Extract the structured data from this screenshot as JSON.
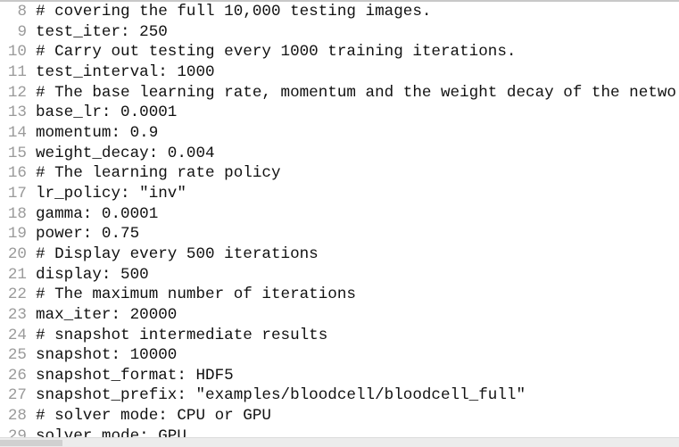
{
  "editor": {
    "lines": [
      {
        "n": "8",
        "text": "# covering the full 10,000 testing images."
      },
      {
        "n": "9",
        "text": "test_iter: 250"
      },
      {
        "n": "10",
        "text": "# Carry out testing every 1000 training iterations."
      },
      {
        "n": "11",
        "text": "test_interval: 1000"
      },
      {
        "n": "12",
        "text": "# The base learning rate, momentum and the weight decay of the netwo"
      },
      {
        "n": "13",
        "text": "base_lr: 0.0001"
      },
      {
        "n": "14",
        "text": "momentum: 0.9"
      },
      {
        "n": "15",
        "text": "weight_decay: 0.004"
      },
      {
        "n": "16",
        "text": "# The learning rate policy"
      },
      {
        "n": "17",
        "text": "lr_policy: \"inv\""
      },
      {
        "n": "18",
        "text": "gamma: 0.0001"
      },
      {
        "n": "19",
        "text": "power: 0.75"
      },
      {
        "n": "20",
        "text": "# Display every 500 iterations"
      },
      {
        "n": "21",
        "text": "display: 500"
      },
      {
        "n": "22",
        "text": "# The maximum number of iterations"
      },
      {
        "n": "23",
        "text": "max_iter: 20000"
      },
      {
        "n": "24",
        "text": "# snapshot intermediate results"
      },
      {
        "n": "25",
        "text": "snapshot: 10000"
      },
      {
        "n": "26",
        "text": "snapshot_format: HDF5"
      },
      {
        "n": "27",
        "text": "snapshot_prefix: \"examples/bloodcell/bloodcell_full\""
      },
      {
        "n": "28",
        "text": "# solver mode: CPU or GPU"
      },
      {
        "n": "29",
        "text": "solver_mode: GPU"
      }
    ]
  }
}
